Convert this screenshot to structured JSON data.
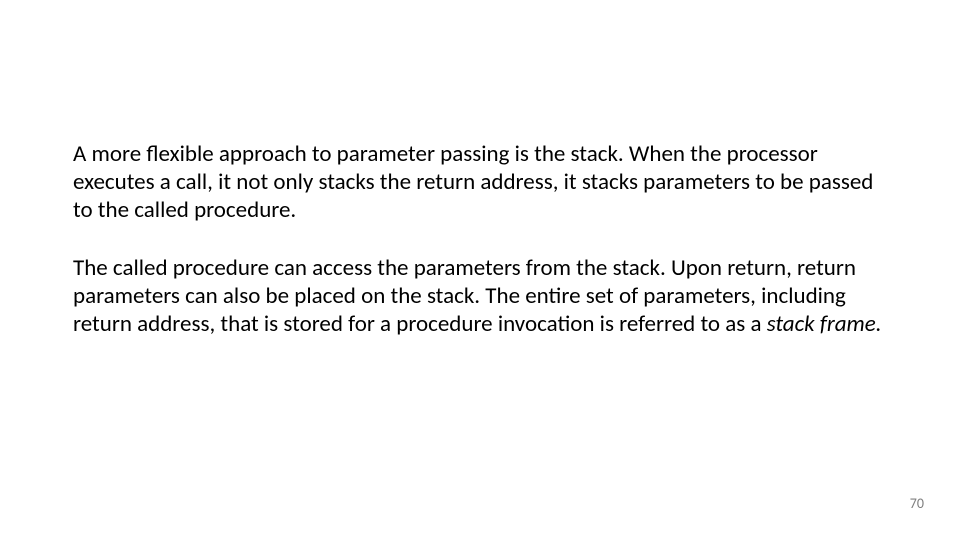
{
  "body": {
    "paragraph1": "A more flexible approach to parameter passing is the stack. When the processor executes a call, it not only stacks the return address, it stacks parameters to be passed to the called procedure.",
    "paragraph2_pre": "The called procedure can access the parameters from the stack. Upon return, return parameters can also be placed on the stack. The entire set of parameters, including return address, that is stored for a procedure invocation is referred to as a ",
    "paragraph2_italic": "stack frame.",
    "paragraph2_post": ""
  },
  "page_number": "70"
}
